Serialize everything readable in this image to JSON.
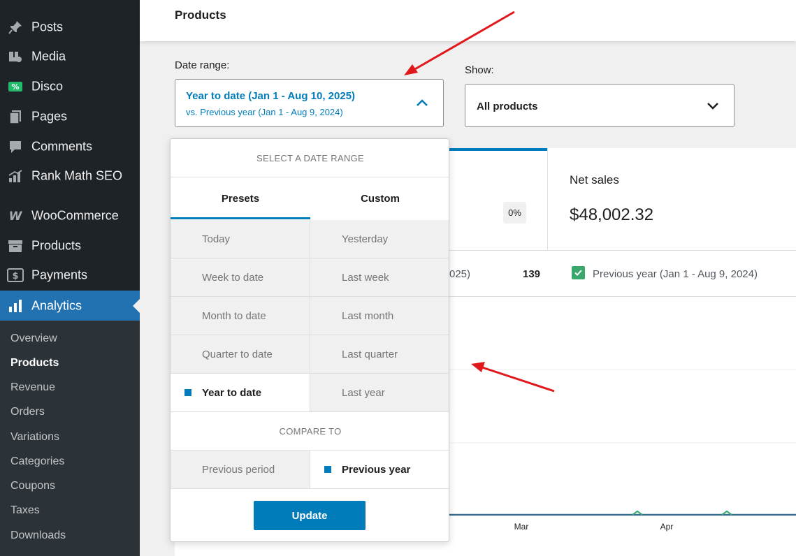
{
  "sidebar": {
    "items": [
      {
        "label": "Posts",
        "icon": "pin-icon"
      },
      {
        "label": "Media",
        "icon": "media-icon"
      },
      {
        "label": "Disco",
        "icon": "discount-icon"
      },
      {
        "label": "Pages",
        "icon": "pages-icon"
      },
      {
        "label": "Comments",
        "icon": "comments-icon"
      },
      {
        "label": "Rank Math SEO",
        "icon": "rank-math-icon"
      },
      {
        "label": "WooCommerce",
        "icon": "woocommerce-icon"
      },
      {
        "label": "Products",
        "icon": "archive-icon"
      },
      {
        "label": "Payments",
        "icon": "dollar-icon"
      },
      {
        "label": "Analytics",
        "icon": "chart-bar-icon"
      }
    ],
    "submenu": [
      "Overview",
      "Products",
      "Revenue",
      "Orders",
      "Variations",
      "Categories",
      "Coupons",
      "Taxes",
      "Downloads"
    ]
  },
  "header": {
    "title": "Products"
  },
  "filters": {
    "date_label": "Date range:",
    "date_main": "Year to date (Jan 1 - Aug 10, 2025)",
    "date_compare": "vs. Previous year (Jan 1 - Aug 9, 2024)",
    "show_label": "Show:",
    "show_value": "All products"
  },
  "summary": {
    "change_badge": "0%",
    "net_sales_label": "Net sales",
    "net_sales_value": "$48,002.32"
  },
  "legend": {
    "fragment": "025)",
    "count": "139",
    "previous_label": "Previous year (Jan 1 - Aug 9, 2024)"
  },
  "chart": {
    "x_ticks": [
      "Mar",
      "Apr"
    ]
  },
  "popover": {
    "heading": "SELECT A DATE RANGE",
    "tabs": [
      "Presets",
      "Custom"
    ],
    "presets": [
      [
        "Today",
        "Yesterday"
      ],
      [
        "Week to date",
        "Last week"
      ],
      [
        "Month to date",
        "Last month"
      ],
      [
        "Quarter to date",
        "Last quarter"
      ],
      [
        "Year to date",
        "Last year"
      ]
    ],
    "compare_heading": "COMPARE TO",
    "compare": [
      "Previous period",
      "Previous year"
    ],
    "update_label": "Update"
  },
  "colors": {
    "sidebar_bg": "#1d2327",
    "accent": "#007cba",
    "active_menu": "#2271b1",
    "check_green": "#3aa76d",
    "annotation_red": "#e0181b"
  }
}
